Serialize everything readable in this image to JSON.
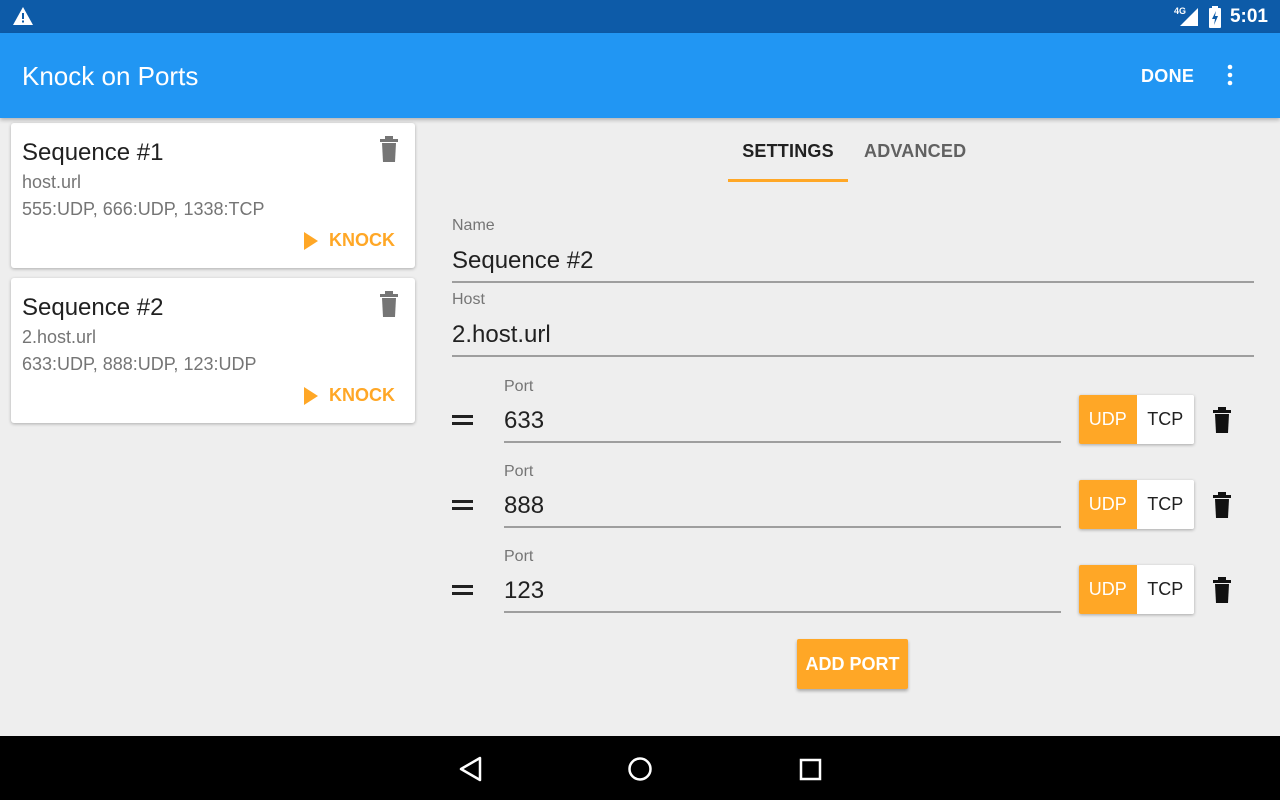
{
  "status_bar": {
    "network": "4G",
    "time": "5:01"
  },
  "app_bar": {
    "title": "Knock on Ports",
    "done_label": "DONE"
  },
  "sequences": [
    {
      "title": "Sequence #1",
      "host": "host.url",
      "ports": "555:UDP, 666:UDP, 1338:TCP",
      "knock_label": "KNOCK"
    },
    {
      "title": "Sequence #2",
      "host": "2.host.url",
      "ports": "633:UDP, 888:UDP, 123:UDP",
      "knock_label": "KNOCK"
    }
  ],
  "tabs": [
    {
      "label": "SETTINGS",
      "active": true
    },
    {
      "label": "ADVANCED",
      "active": false
    }
  ],
  "settings": {
    "name_label": "Name",
    "name_value": "Sequence #2",
    "host_label": "Host",
    "host_value": "2.host.url",
    "ports": [
      {
        "label": "Port",
        "value": "633",
        "udp": "UDP",
        "tcp": "TCP",
        "selected": "UDP"
      },
      {
        "label": "Port",
        "value": "888",
        "udp": "UDP",
        "tcp": "TCP",
        "selected": "UDP"
      },
      {
        "label": "Port",
        "value": "123",
        "udp": "UDP",
        "tcp": "TCP",
        "selected": "UDP"
      }
    ],
    "add_port_label": "ADD PORT"
  },
  "colors": {
    "status_bar": "#0d5ba8",
    "app_bar": "#2196f3",
    "accent": "#ffa726",
    "background": "#eeeeee"
  },
  "icons": [
    "warning-icon",
    "signal-icon",
    "battery-icon",
    "more-vert-icon",
    "delete-icon",
    "play-icon",
    "drag-handle-icon",
    "back-icon",
    "home-icon",
    "recents-icon"
  ]
}
